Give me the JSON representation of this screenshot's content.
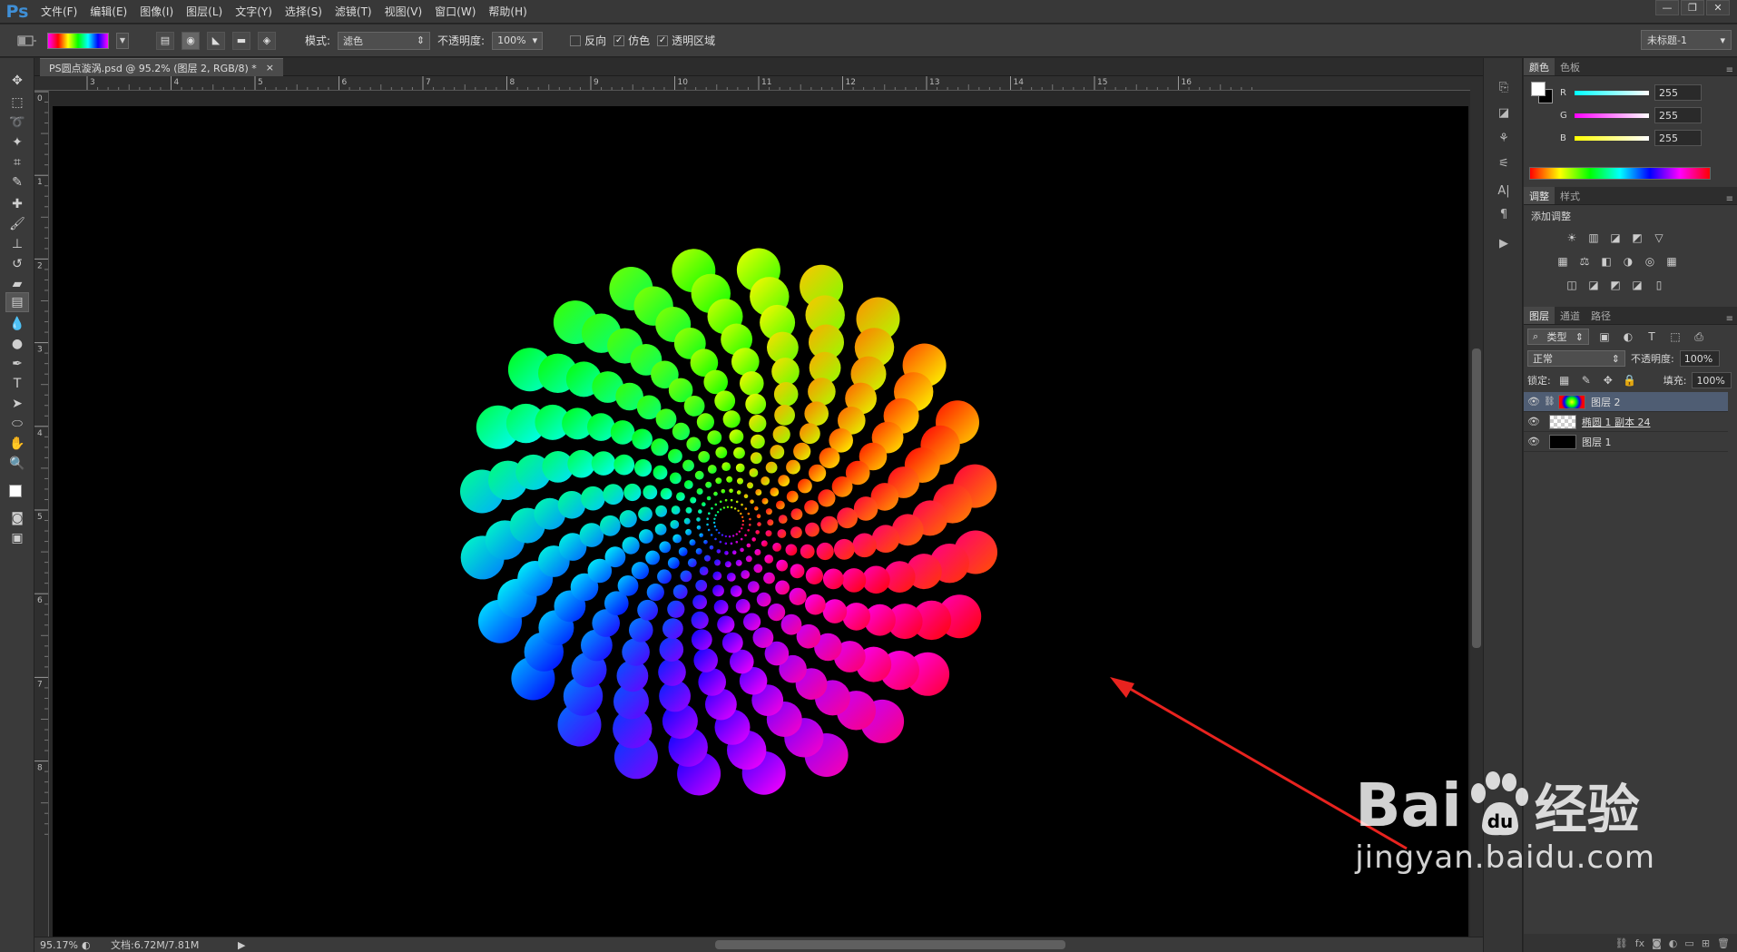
{
  "app": {
    "logo": "Ps"
  },
  "menu": [
    "文件(F)",
    "编辑(E)",
    "图像(I)",
    "图层(L)",
    "文字(Y)",
    "选择(S)",
    "滤镜(T)",
    "视图(V)",
    "窗口(W)",
    "帮助(H)"
  ],
  "window_controls": {
    "minimize": "—",
    "restore": "❐",
    "close": "✕"
  },
  "options": {
    "mode_label": "模式:",
    "mode_value": "滤色",
    "opacity_label": "不透明度:",
    "opacity_value": "100%",
    "reverse_label": "反向",
    "dither_label": "仿色",
    "transparency_label": "透明区域",
    "reverse_checked": false,
    "dither_checked": true,
    "transparency_checked": true,
    "workspace": "未标题-1"
  },
  "document": {
    "tab_title": "PS圆点漩涡.psd @ 95.2% (图层 2, RGB/8) *",
    "tab_close": "×",
    "zoom": "95.17%",
    "doc_info": "文档:6.72M/7.81M",
    "canvas_color": "#000000"
  },
  "rulers": {
    "top": [
      "3",
      "4",
      "5",
      "6",
      "7",
      "8",
      "9",
      "10",
      "11",
      "12",
      "13",
      "14",
      "15",
      "16"
    ],
    "left": [
      "0",
      "1",
      "2",
      "3",
      "4",
      "5",
      "6",
      "7",
      "8"
    ]
  },
  "color_panel": {
    "tabs": [
      "颜色",
      "色板"
    ],
    "channels": [
      {
        "name": "R",
        "value": "255",
        "color": "#ff3c3c"
      },
      {
        "name": "G",
        "value": "255",
        "color": "#3cff3c"
      },
      {
        "name": "B",
        "value": "255",
        "color": "#5a5aff"
      }
    ]
  },
  "adjust_panel": {
    "tabs": [
      "调整",
      "样式"
    ],
    "heading": "添加调整",
    "icons": [
      "☀",
      "▥",
      "◪",
      "◩",
      "▽",
      "▦",
      "⚖",
      "◧",
      "◑",
      "◎",
      "▦",
      "◫",
      "◪",
      "◩",
      "◪",
      "▯"
    ]
  },
  "layers_panel": {
    "tabs": [
      "图层",
      "通道",
      "路径"
    ],
    "filter_label": "类型",
    "blend_mode": "正常",
    "opacity_label": "不透明度:",
    "opacity_value": "100%",
    "lock_label": "锁定:",
    "fill_label": "填充:",
    "fill_value": "100%",
    "layers": [
      {
        "name": "图层 2",
        "selected": true,
        "thumb": "gradient"
      },
      {
        "name": "椭圆 1 副本 24",
        "selected": false,
        "thumb": "transparent"
      },
      {
        "name": "图层 1",
        "selected": false,
        "thumb": "black"
      }
    ]
  },
  "watermark": {
    "brand": "Bai",
    "brand2": "du",
    "cn": "经验",
    "url": "jingyan.baidu.com"
  },
  "annotation_color": "#e8231f"
}
